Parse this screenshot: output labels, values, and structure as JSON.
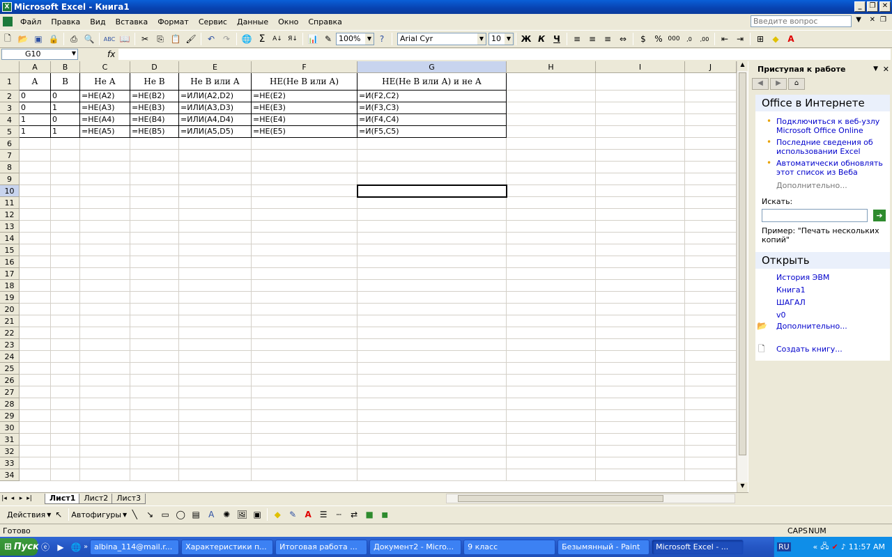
{
  "window": {
    "title": "Microsoft Excel - Книга1",
    "app_icon": "X"
  },
  "menu": {
    "items": [
      "Файл",
      "Правка",
      "Вид",
      "Вставка",
      "Формат",
      "Сервис",
      "Данные",
      "Окно",
      "Справка"
    ],
    "ask_placeholder": "Введите вопрос"
  },
  "toolbar": {
    "zoom": "100%",
    "font": "Arial Cyr",
    "size": "10"
  },
  "formula": {
    "cell_ref": "G10",
    "fx": "fx",
    "value": ""
  },
  "columns": [
    "A",
    "B",
    "C",
    "D",
    "E",
    "F",
    "G",
    "H",
    "I",
    "J"
  ],
  "rows": [
    "1",
    "2",
    "3",
    "4",
    "5",
    "6",
    "7",
    "8",
    "9",
    "10",
    "11",
    "12",
    "13",
    "14",
    "15",
    "16",
    "17",
    "18",
    "19",
    "20",
    "21",
    "22",
    "23",
    "24",
    "25",
    "26",
    "27",
    "28",
    "29",
    "30",
    "31",
    "32",
    "33",
    "34"
  ],
  "table": {
    "header": [
      "A",
      "B",
      "Не А",
      "Не В",
      "Не В или А",
      "НЕ(Не В или А)",
      "НЕ(Не В или А)  и не А"
    ],
    "rows": [
      [
        "0",
        "0",
        "=НЕ(A2)",
        "=НЕ(B2)",
        "=ИЛИ(A2,D2)",
        "=НЕ(E2)",
        "=И(F2,C2)"
      ],
      [
        "0",
        "1",
        "=НЕ(A3)",
        "=НЕ(B3)",
        "=ИЛИ(A3,D3)",
        "=НЕ(E3)",
        "=И(F3,C3)"
      ],
      [
        "1",
        "0",
        "=НЕ(A4)",
        "=НЕ(B4)",
        "=ИЛИ(A4,D4)",
        "=НЕ(E4)",
        "=И(F4,C4)"
      ],
      [
        "1",
        "1",
        "=НЕ(A5)",
        "=НЕ(B5)",
        "=ИЛИ(A5,D5)",
        "=НЕ(E5)",
        "=И(F5,C5)"
      ]
    ]
  },
  "sheet_tabs": [
    "Лист1",
    "Лист2",
    "Лист3"
  ],
  "drawing": {
    "actions": "Действия",
    "autoshapes": "Автофигуры"
  },
  "status": {
    "ready": "Готово",
    "caps": "CAPS",
    "num": "NUM"
  },
  "taskpane": {
    "title": "Приступая к работе",
    "online_title": "Office в Интернете",
    "links": [
      "Подключиться к веб-узлу Microsoft Office Online",
      "Последние сведения об использовании Excel",
      "Автоматически обновлять этот список из Веба"
    ],
    "more": "Дополнительно...",
    "search_label": "Искать:",
    "example": "Пример:  \"Печать нескольких копий\"",
    "open_title": "Открыть",
    "files": [
      "История ЭВМ",
      "Книга1",
      "ШАГАЛ",
      "v0"
    ],
    "open_more": "Дополнительно...",
    "create": "Создать книгу..."
  },
  "taskbar": {
    "start": "Пуск",
    "buttons": [
      "albina_114@mail.r...",
      "Характеристики п...",
      "Итоговая работа ...",
      "Документ2 - Micro...",
      "9 класс",
      "Безымянный - Paint",
      "Microsoft Excel - ..."
    ],
    "lang": "RU",
    "clock": "11:57 AM"
  }
}
